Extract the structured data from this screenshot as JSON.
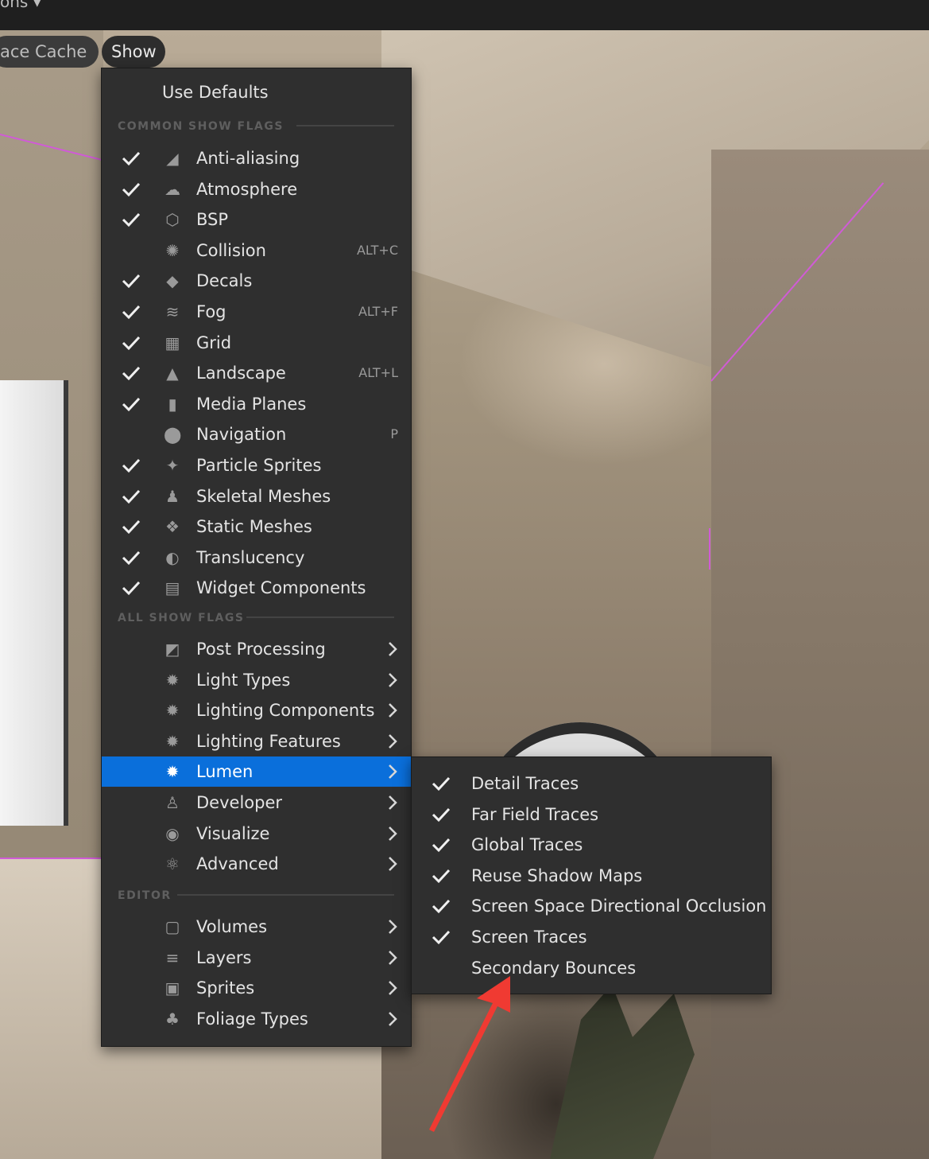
{
  "topbar": {
    "truncated_text": "ons ▾"
  },
  "toolbar": {
    "cache_label": "ace Cache",
    "show_label": "Show"
  },
  "menu": {
    "use_defaults": "Use Defaults",
    "common_header": "COMMON SHOW FLAGS",
    "all_header": "ALL SHOW FLAGS",
    "editor_header": "EDITOR",
    "common": [
      {
        "label": "Anti-aliasing",
        "checked": true,
        "icon": "antialias-icon",
        "shortcut": ""
      },
      {
        "label": "Atmosphere",
        "checked": true,
        "icon": "atmosphere-icon",
        "shortcut": ""
      },
      {
        "label": "BSP",
        "checked": true,
        "icon": "bsp-icon",
        "shortcut": ""
      },
      {
        "label": "Collision",
        "checked": false,
        "icon": "collision-icon",
        "shortcut": "ALT+C"
      },
      {
        "label": "Decals",
        "checked": true,
        "icon": "decals-icon",
        "shortcut": ""
      },
      {
        "label": "Fog",
        "checked": true,
        "icon": "fog-icon",
        "shortcut": "ALT+F"
      },
      {
        "label": "Grid",
        "checked": true,
        "icon": "grid-icon",
        "shortcut": ""
      },
      {
        "label": "Landscape",
        "checked": true,
        "icon": "landscape-icon",
        "shortcut": "ALT+L"
      },
      {
        "label": "Media Planes",
        "checked": true,
        "icon": "media-planes-icon",
        "shortcut": ""
      },
      {
        "label": "Navigation",
        "checked": false,
        "icon": "navigation-pin-icon",
        "shortcut": "P"
      },
      {
        "label": "Particle Sprites",
        "checked": true,
        "icon": "particle-sprites-icon",
        "shortcut": ""
      },
      {
        "label": "Skeletal Meshes",
        "checked": true,
        "icon": "skeletal-mesh-icon",
        "shortcut": ""
      },
      {
        "label": "Static Meshes",
        "checked": true,
        "icon": "static-mesh-icon",
        "shortcut": ""
      },
      {
        "label": "Translucency",
        "checked": true,
        "icon": "translucency-icon",
        "shortcut": ""
      },
      {
        "label": "Widget Components",
        "checked": true,
        "icon": "widget-components-icon",
        "shortcut": ""
      }
    ],
    "all": [
      {
        "label": "Post Processing",
        "icon": "post-processing-icon"
      },
      {
        "label": "Light Types",
        "icon": "light-types-icon"
      },
      {
        "label": "Lighting Components",
        "icon": "lighting-components-icon"
      },
      {
        "label": "Lighting Features",
        "icon": "lighting-features-icon"
      },
      {
        "label": "Lumen",
        "icon": "lumen-icon",
        "selected": true
      },
      {
        "label": "Developer",
        "icon": "developer-icon"
      },
      {
        "label": "Visualize",
        "icon": "visualize-icon"
      },
      {
        "label": "Advanced",
        "icon": "advanced-icon"
      }
    ],
    "editor": [
      {
        "label": "Volumes",
        "icon": "volumes-icon"
      },
      {
        "label": "Layers",
        "icon": "layers-icon"
      },
      {
        "label": "Sprites",
        "icon": "sprites-icon"
      },
      {
        "label": "Foliage Types",
        "icon": "foliage-types-icon"
      }
    ]
  },
  "lumen_submenu": [
    {
      "label": "Detail Traces",
      "checked": true
    },
    {
      "label": "Far Field Traces",
      "checked": true
    },
    {
      "label": "Global Traces",
      "checked": true
    },
    {
      "label": "Reuse Shadow Maps",
      "checked": true
    },
    {
      "label": "Screen Space Directional Occlusion",
      "checked": true
    },
    {
      "label": "Screen Traces",
      "checked": true
    },
    {
      "label": "Secondary Bounces",
      "checked": false
    }
  ],
  "colors": {
    "selection": "#0a6fdb",
    "menu_bg": "#2f2f2f",
    "annotation_arrow": "#f03a32"
  }
}
